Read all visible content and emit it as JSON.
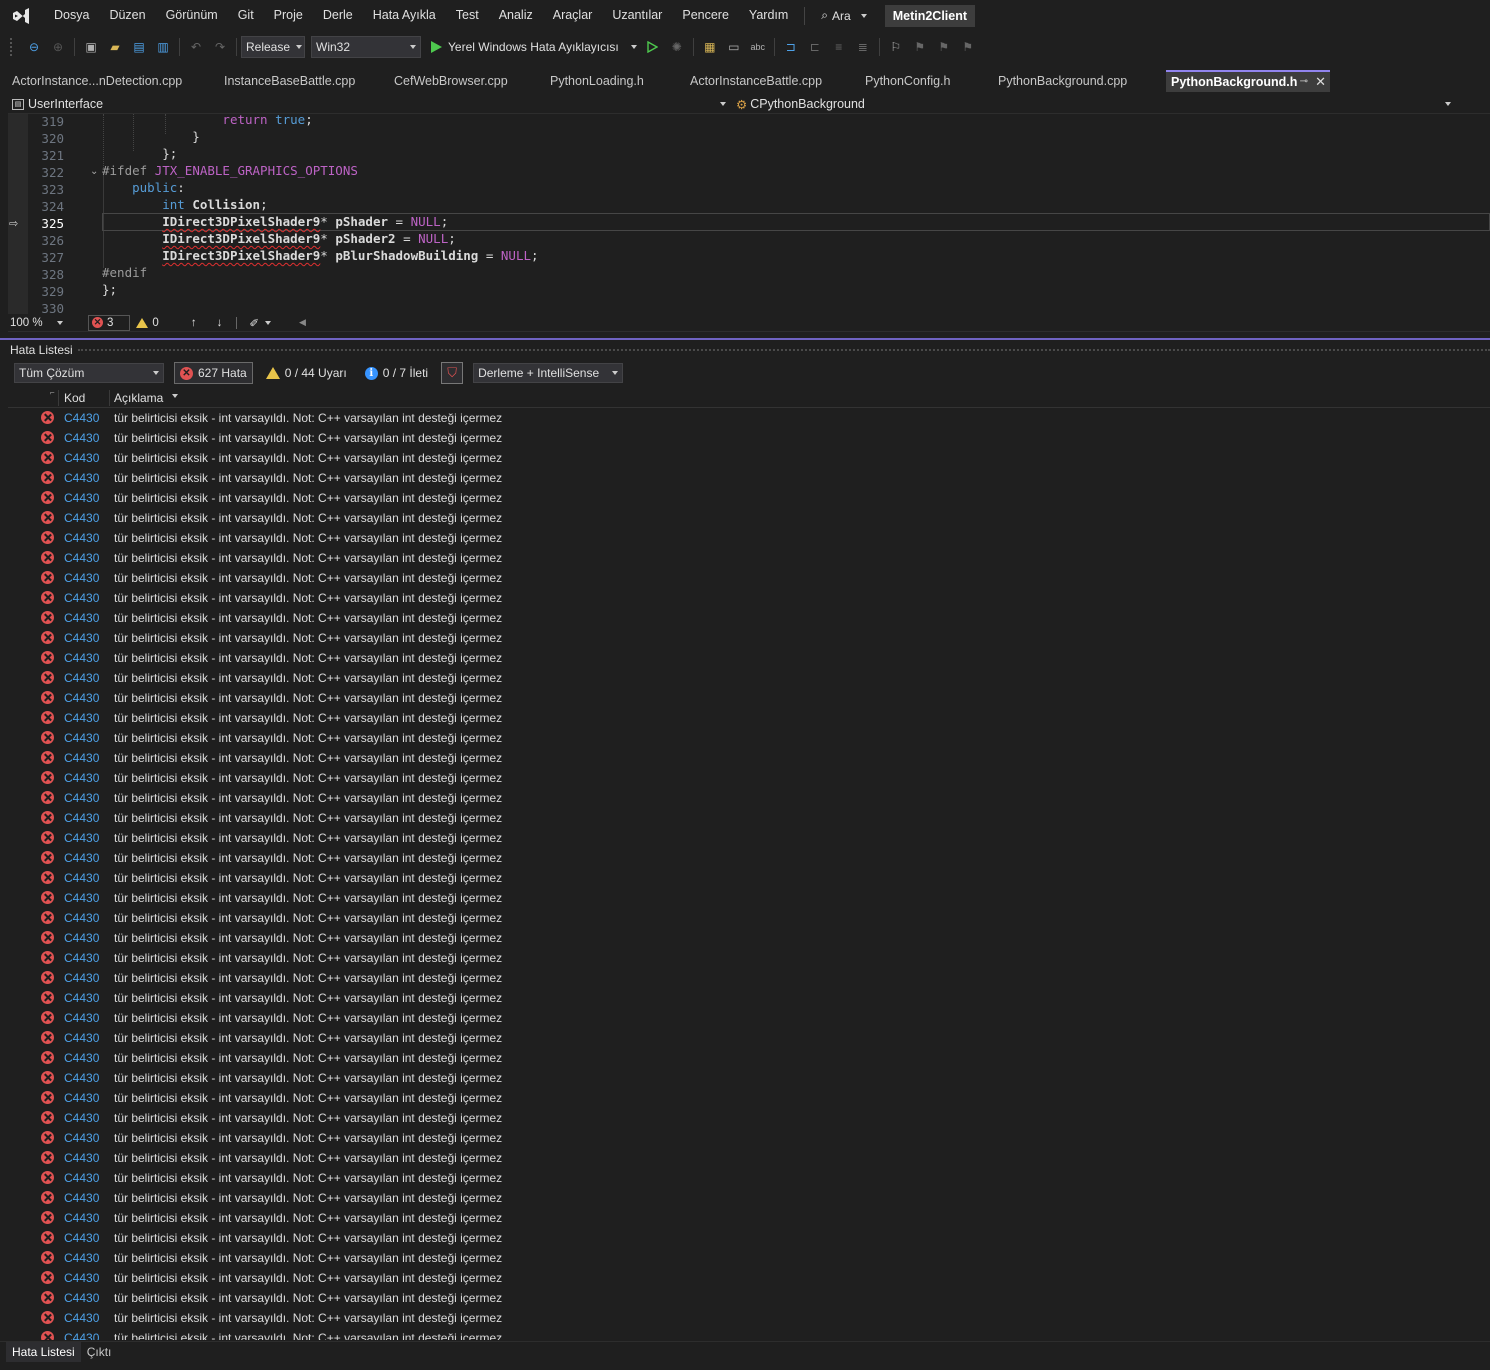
{
  "menubar": {
    "items": [
      "Dosya",
      "Düzen",
      "Görünüm",
      "Git",
      "Proje",
      "Derle",
      "Hata Ayıkla",
      "Test",
      "Analiz",
      "Araçlar",
      "Uzantılar",
      "Pencere",
      "Yardım"
    ],
    "search_label": "Ara",
    "solution_name": "Metin2Client"
  },
  "toolbar": {
    "configuration": "Release",
    "platform": "Win32",
    "debugger_label": "Yerel Windows Hata Ayıklayıcısı"
  },
  "tabs": [
    {
      "label": "ActorInstance...nDetection.cpp"
    },
    {
      "label": "InstanceBaseBattle.cpp"
    },
    {
      "label": "CefWebBrowser.cpp"
    },
    {
      "label": "PythonLoading.h"
    },
    {
      "label": "ActorInstanceBattle.cpp"
    },
    {
      "label": "PythonConfig.h"
    },
    {
      "label": "PythonBackground.cpp"
    },
    {
      "label": "PythonBackground.h",
      "active": true
    }
  ],
  "navbar": {
    "project": "UserInterface",
    "scope": "CPythonBackground"
  },
  "editor": {
    "line_numbers": [
      "319",
      "320",
      "321",
      "322",
      "323",
      "324",
      "325",
      "326",
      "327",
      "328",
      "329",
      "330"
    ],
    "current_line": "325"
  },
  "editor_status": {
    "zoom": "100 %",
    "errors": "3",
    "warnings": "0"
  },
  "error_list": {
    "title": "Hata Listesi",
    "scope_filter": "Tüm Çözüm",
    "errors_button": "627 Hata",
    "warnings_button": "0 / 44 Uyarı",
    "messages_button": "0 / 7 İleti",
    "source_filter": "Derleme + IntelliSense",
    "columns": {
      "code": "Kod",
      "description": "Açıklama"
    },
    "row_code": "C4430",
    "row_description": "tür belirticisi eksik - int varsayıldı. Not: C++ varsayılan int desteği içermez"
  },
  "bottom_tabs": [
    "Hata Listesi",
    "Çıktı"
  ],
  "colors": {
    "accent": "#9184ee",
    "error": "#e05252",
    "warning": "#e8c44a",
    "info": "#3794ff",
    "code_link": "#4ea1e8"
  }
}
